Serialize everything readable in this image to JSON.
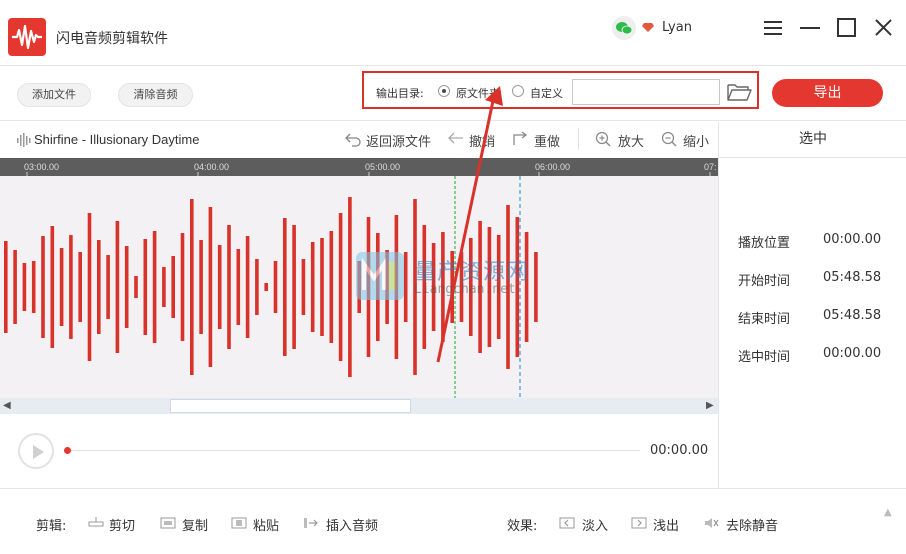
{
  "app": {
    "title": "闪电音频剪辑软件",
    "username": "Lyan",
    "accent": "#e4372f"
  },
  "toolbar": {
    "add_file": "添加文件",
    "clear_audio": "清除音频",
    "output_dir_label": "输出目录:",
    "option_original": "原文件夹",
    "option_custom": "自定义",
    "selected_option": "原文件夹",
    "path_value": "",
    "export": "导出"
  },
  "editor": {
    "track_name": "Shirfine - Illusionary Daytime",
    "tools": {
      "back_to_source": "返回源文件",
      "undo": "撤销",
      "redo": "重做",
      "zoom_in": "放大",
      "zoom_out": "缩小"
    },
    "ruler_ticks": [
      "03:00.00",
      "04:00.00",
      "05:00.00",
      "06:00.00",
      "07:"
    ],
    "waveform_color": "#d9322b"
  },
  "player": {
    "current_time": "00:00.00"
  },
  "selection_panel": {
    "title": "选中",
    "rows": [
      {
        "label": "播放位置",
        "value": "00:00.00"
      },
      {
        "label": "开始时间",
        "value": "05:48.58"
      },
      {
        "label": "结束时间",
        "value": "05:48.58"
      },
      {
        "label": "选中时间",
        "value": "00:00.00"
      }
    ]
  },
  "bottom": {
    "edit_label": "剪辑:",
    "cut": "剪切",
    "copy": "复制",
    "paste": "粘贴",
    "insert_audio": "插入音频",
    "effects_label": "效果:",
    "fade_in": "淡入",
    "fade_out": "浅出",
    "remove_silence": "去除静音"
  },
  "watermark": {
    "cn": "量产资源网",
    "en": "Liangchan.net"
  }
}
